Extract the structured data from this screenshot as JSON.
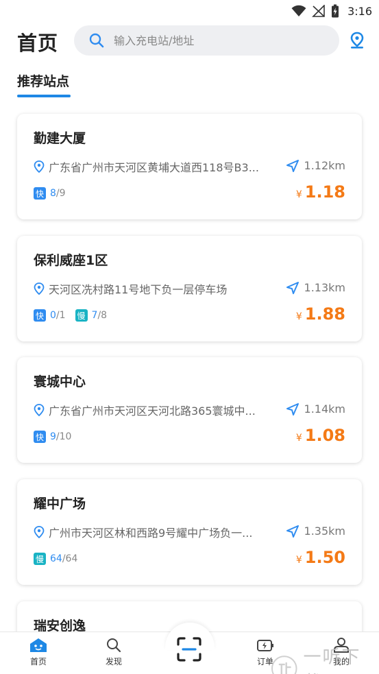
{
  "status_bar": {
    "time": "3:16"
  },
  "header": {
    "title": "首页",
    "search_placeholder": "输入充电站/地址"
  },
  "section": {
    "title": "推荐站点"
  },
  "stations": [
    {
      "name": "勤建大厦",
      "address": "广东省广州市天河区黄埔大道西118号B3...",
      "distance": "1.12km",
      "fast_label": "快",
      "fast_available": "8",
      "fast_total": "/9",
      "slow_label": "",
      "slow_available": "",
      "slow_total": "",
      "currency": "¥",
      "price": "1.18"
    },
    {
      "name": "保利威座1区",
      "address": "天河区冼村路11号地下负一层停车场",
      "distance": "1.13km",
      "fast_label": "快",
      "fast_available": "0",
      "fast_total": "/1",
      "slow_label": "慢",
      "slow_available": "7",
      "slow_total": "/8",
      "currency": "¥",
      "price": "1.88"
    },
    {
      "name": "寰城中心",
      "address": "广东省广州市天河区天河北路365寰城中...",
      "distance": "1.14km",
      "fast_label": "快",
      "fast_available": "9",
      "fast_total": "/10",
      "slow_label": "",
      "slow_available": "",
      "slow_total": "",
      "currency": "¥",
      "price": "1.08"
    },
    {
      "name": "耀中广场",
      "address": "广州市天河区林和西路9号耀中广场负一...",
      "distance": "1.35km",
      "fast_label": "",
      "fast_available": "",
      "fast_total": "",
      "slow_label": "慢",
      "slow_available": "64",
      "slow_total": "/64",
      "currency": "¥",
      "price": "1.50"
    },
    {
      "name": "瑞安创逸"
    }
  ],
  "bottom_nav": {
    "home": "首页",
    "discover": "发现",
    "orders": "订单",
    "mine": "我的"
  },
  "watermark": {
    "text": "一听下载"
  },
  "colors": {
    "accent": "#1e88e5",
    "price": "#f47a16",
    "fast_tag": "#2f8cf0",
    "slow_tag": "#19b3c4"
  }
}
